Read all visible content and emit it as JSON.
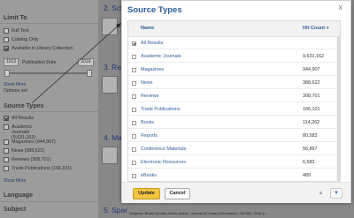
{
  "sidebar": {
    "limit_to": {
      "title": "Limit To",
      "options": [
        {
          "label": "Full Text",
          "checked": false
        },
        {
          "label": "Catalog Only",
          "checked": false
        },
        {
          "label": "Available in Library Collection",
          "checked": true
        }
      ],
      "year_from": "1013",
      "date_label": "Publication Date",
      "year_to": "2016",
      "show_more": "Show More",
      "options_set": "Options set"
    },
    "source_types": {
      "title": "Source Types",
      "items": [
        {
          "label": "All Results",
          "checked": true
        },
        {
          "label": "Academic Journals (9,631,162)",
          "checked": false
        },
        {
          "label": "Magazines (944,907)",
          "checked": false
        },
        {
          "label": "News (388,622)",
          "checked": false
        },
        {
          "label": "Reviews (308,701)",
          "checked": false
        },
        {
          "label": "Trade Publications (166,101)",
          "checked": false
        }
      ],
      "show_more": "Show More"
    },
    "language": {
      "title": "Language"
    },
    "subject": {
      "title": "Subject"
    }
  },
  "results": [
    {
      "number": "2.",
      "title": "Scie"
    },
    {
      "number": "3.",
      "title": "Revie"
    },
    {
      "number": "4.",
      "title": "Maki"
    },
    {
      "number": "5.",
      "title": "Spar"
    }
  ],
  "bottom_citation": "Subjects: Board Nurses, Music Active...Journal of Library Information...Vol 000, 2016 p...",
  "modal": {
    "title": "Source Types",
    "close_label": "X",
    "columns": {
      "name": "Name",
      "hit_count": "Hit Count"
    },
    "rows": [
      {
        "name": "All Results",
        "hits": "",
        "checked": true
      },
      {
        "name": "Academic Journals",
        "hits": "9,631,162",
        "checked": false
      },
      {
        "name": "Magazines",
        "hits": "944,907",
        "checked": false
      },
      {
        "name": "News",
        "hits": "388,622",
        "checked": false
      },
      {
        "name": "Reviews",
        "hits": "308,701",
        "checked": false
      },
      {
        "name": "Trade Publications",
        "hits": "166,101",
        "checked": false
      },
      {
        "name": "Books",
        "hits": "114,262",
        "checked": false
      },
      {
        "name": "Reports",
        "hits": "80,583",
        "checked": false
      },
      {
        "name": "Conference Materials",
        "hits": "56,867",
        "checked": false
      },
      {
        "name": "Electronic Resources",
        "hits": "6,583",
        "checked": false
      },
      {
        "name": "eBooks",
        "hits": "489",
        "checked": false
      }
    ],
    "update_label": "Update",
    "cancel_label": "Cancel"
  },
  "colors": {
    "link_blue": "#2e5c99",
    "update_button": "#f4c542",
    "overlay_gray": "#888888"
  },
  "icons": [
    "checkbox-icon",
    "sort-arrow-icon",
    "close-icon",
    "arrow-up-icon",
    "arrow-down-icon"
  ]
}
